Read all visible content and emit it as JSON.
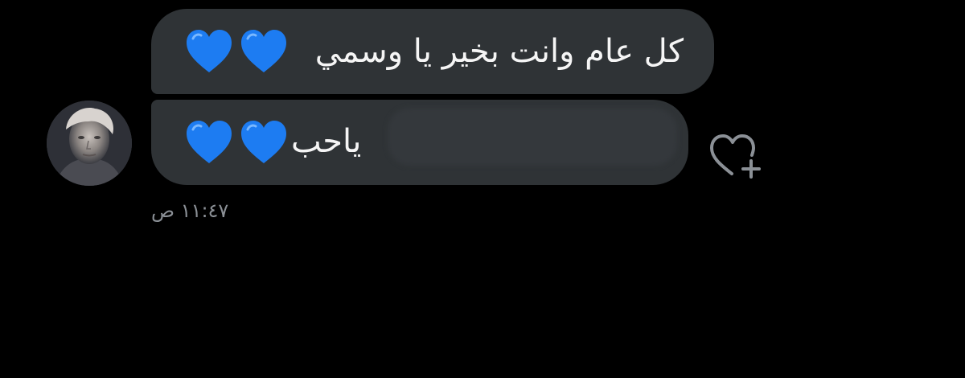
{
  "chat": {
    "messages": [
      {
        "text": "كل عام وانت بخير يا وسمي",
        "emoji": "blue-heart",
        "emoji_count": 2
      },
      {
        "text": "ياحب",
        "emoji": "blue-heart",
        "emoji_count": 2
      }
    ],
    "timestamp": "١١:٤٧ ص",
    "avatar_icon": "user-avatar-photo",
    "react_icon": "heart-plus-icon"
  },
  "colors": {
    "background": "#000000",
    "bubble": "#2f3336",
    "text": "#f5f5f5",
    "timestamp": "#8b9096",
    "heart": "#1d7cf2",
    "react_icon": "#8b9096"
  }
}
